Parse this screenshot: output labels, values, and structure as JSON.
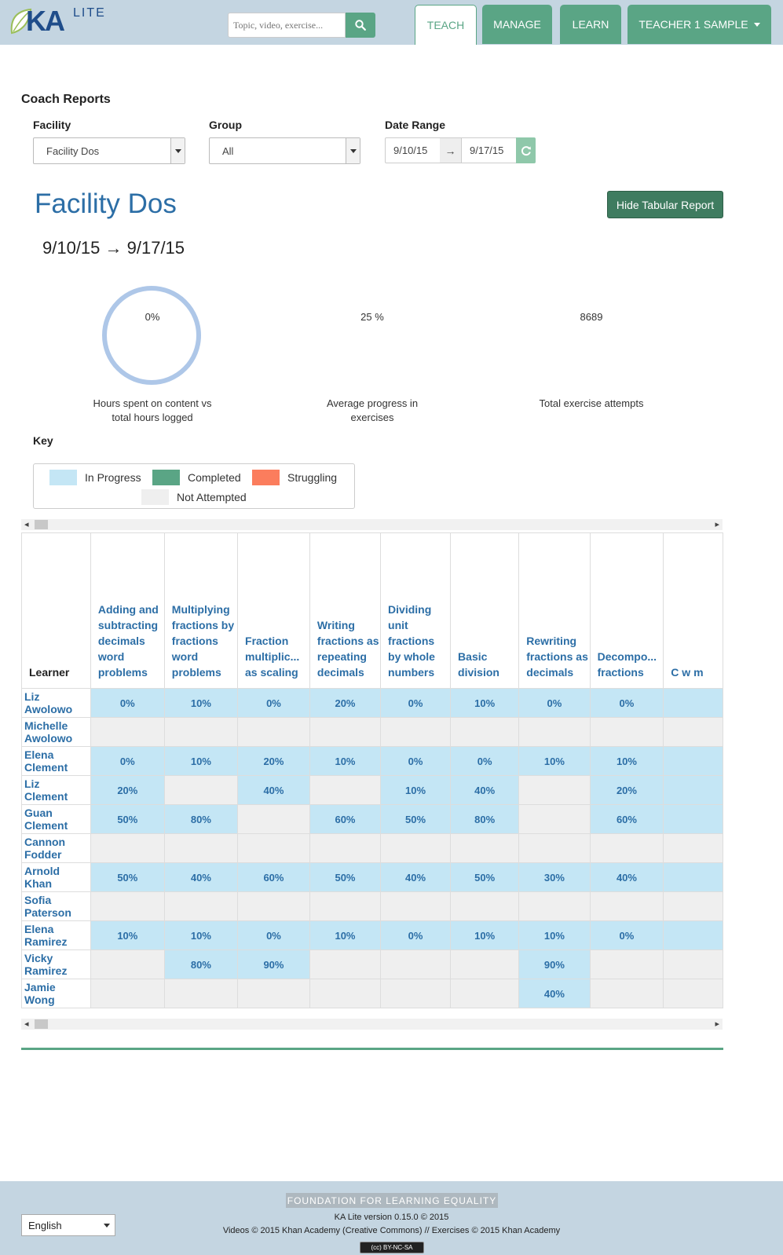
{
  "nav": {
    "logo_ka": "KA",
    "logo_lite": "LITE",
    "search_placeholder": "Topic, video, exercise...",
    "tabs": [
      {
        "label": "TEACH"
      },
      {
        "label": "MANAGE"
      },
      {
        "label": "LEARN"
      },
      {
        "label": "TEACHER 1 SAMPLE"
      }
    ]
  },
  "filters": {
    "page_title": "Coach Reports",
    "facility_label": "Facility",
    "facility_value": "Facility Dos",
    "group_label": "Group",
    "group_value": "All",
    "date_label": "Date Range",
    "date_start": "9/10/15",
    "date_sep": "→",
    "date_end": "9/17/15"
  },
  "report": {
    "title": "Facility Dos",
    "date_range": "9/10/15 → 9/17/15",
    "hide_button": "Hide Tabular Report",
    "stats": [
      {
        "value": "0%",
        "label_line1": "Hours spent on content vs",
        "label_line2": "total hours logged"
      },
      {
        "value": "25 %",
        "label_line1": "Average progress in",
        "label_line2": "exercises"
      },
      {
        "value": "8689",
        "label_line1": "Total exercise attempts",
        "label_line2": ""
      }
    ],
    "donut_fraction": 0,
    "key_title": "Key",
    "key": [
      {
        "label": "In Progress",
        "color": "#c4e6f5"
      },
      {
        "label": "Completed",
        "color": "#5aa585"
      },
      {
        "label": "Struggling",
        "color": "#fb7d5d"
      },
      {
        "label": "Not Attempted",
        "color": "#efefef"
      }
    ]
  },
  "table": {
    "learner_header": "Learner",
    "columns": [
      "Adding and subtracting decimals word problems",
      "Multiplying fractions by fractions word problems",
      "Fraction multiplic... as scaling",
      "Writing fractions as repeating decimals",
      "Dividing unit fractions by whole numbers",
      "Basic division",
      "Rewriting fractions as decimals",
      "Decompo... fractions",
      "C w m"
    ],
    "rows": [
      {
        "first": "Liz",
        "last": "Awolowo",
        "cells": [
          "0%",
          "10%",
          "0%",
          "20%",
          "0%",
          "10%",
          "0%",
          "0%",
          ""
        ]
      },
      {
        "first": "Michelle",
        "last": "Awolowo",
        "cells": [
          null,
          null,
          null,
          null,
          null,
          null,
          null,
          null,
          null
        ]
      },
      {
        "first": "Elena",
        "last": "Clement",
        "cells": [
          "0%",
          "10%",
          "20%",
          "10%",
          "0%",
          "0%",
          "10%",
          "10%",
          ""
        ]
      },
      {
        "first": "Liz",
        "last": "Clement",
        "cells": [
          "20%",
          null,
          "40%",
          null,
          "10%",
          "40%",
          null,
          "20%",
          ""
        ]
      },
      {
        "first": "Guan",
        "last": "Clement",
        "cells": [
          "50%",
          "80%",
          null,
          "60%",
          "50%",
          "80%",
          null,
          "60%",
          ""
        ]
      },
      {
        "first": "Cannon",
        "last": "Fodder",
        "cells": [
          null,
          null,
          null,
          null,
          null,
          null,
          null,
          null,
          null
        ]
      },
      {
        "first": "Arnold",
        "last": "Khan",
        "cells": [
          "50%",
          "40%",
          "60%",
          "50%",
          "40%",
          "50%",
          "30%",
          "40%",
          ""
        ]
      },
      {
        "first": "Sofia",
        "last": "Paterson",
        "cells": [
          null,
          null,
          null,
          null,
          null,
          null,
          null,
          null,
          null
        ]
      },
      {
        "first": "Elena",
        "last": "Ramirez",
        "cells": [
          "10%",
          "10%",
          "0%",
          "10%",
          "0%",
          "10%",
          "10%",
          "0%",
          ""
        ]
      },
      {
        "first": "Vicky",
        "last": "Ramirez",
        "cells": [
          null,
          "80%",
          "90%",
          null,
          null,
          null,
          "90%",
          null,
          null
        ]
      },
      {
        "first": "Jamie",
        "last": "Wong",
        "cells": [
          null,
          null,
          null,
          null,
          null,
          null,
          "40%",
          null,
          null
        ]
      }
    ]
  },
  "footer": {
    "language": "English",
    "fle": "FOUNDATION FOR LEARNING EQUALITY",
    "version": "KA Lite version 0.15.0 © 2015",
    "credits": "Videos © 2015 Khan Academy (Creative Commons) // Exercises © 2015 Khan Academy",
    "license": "(cc) BY-NC-SA"
  }
}
